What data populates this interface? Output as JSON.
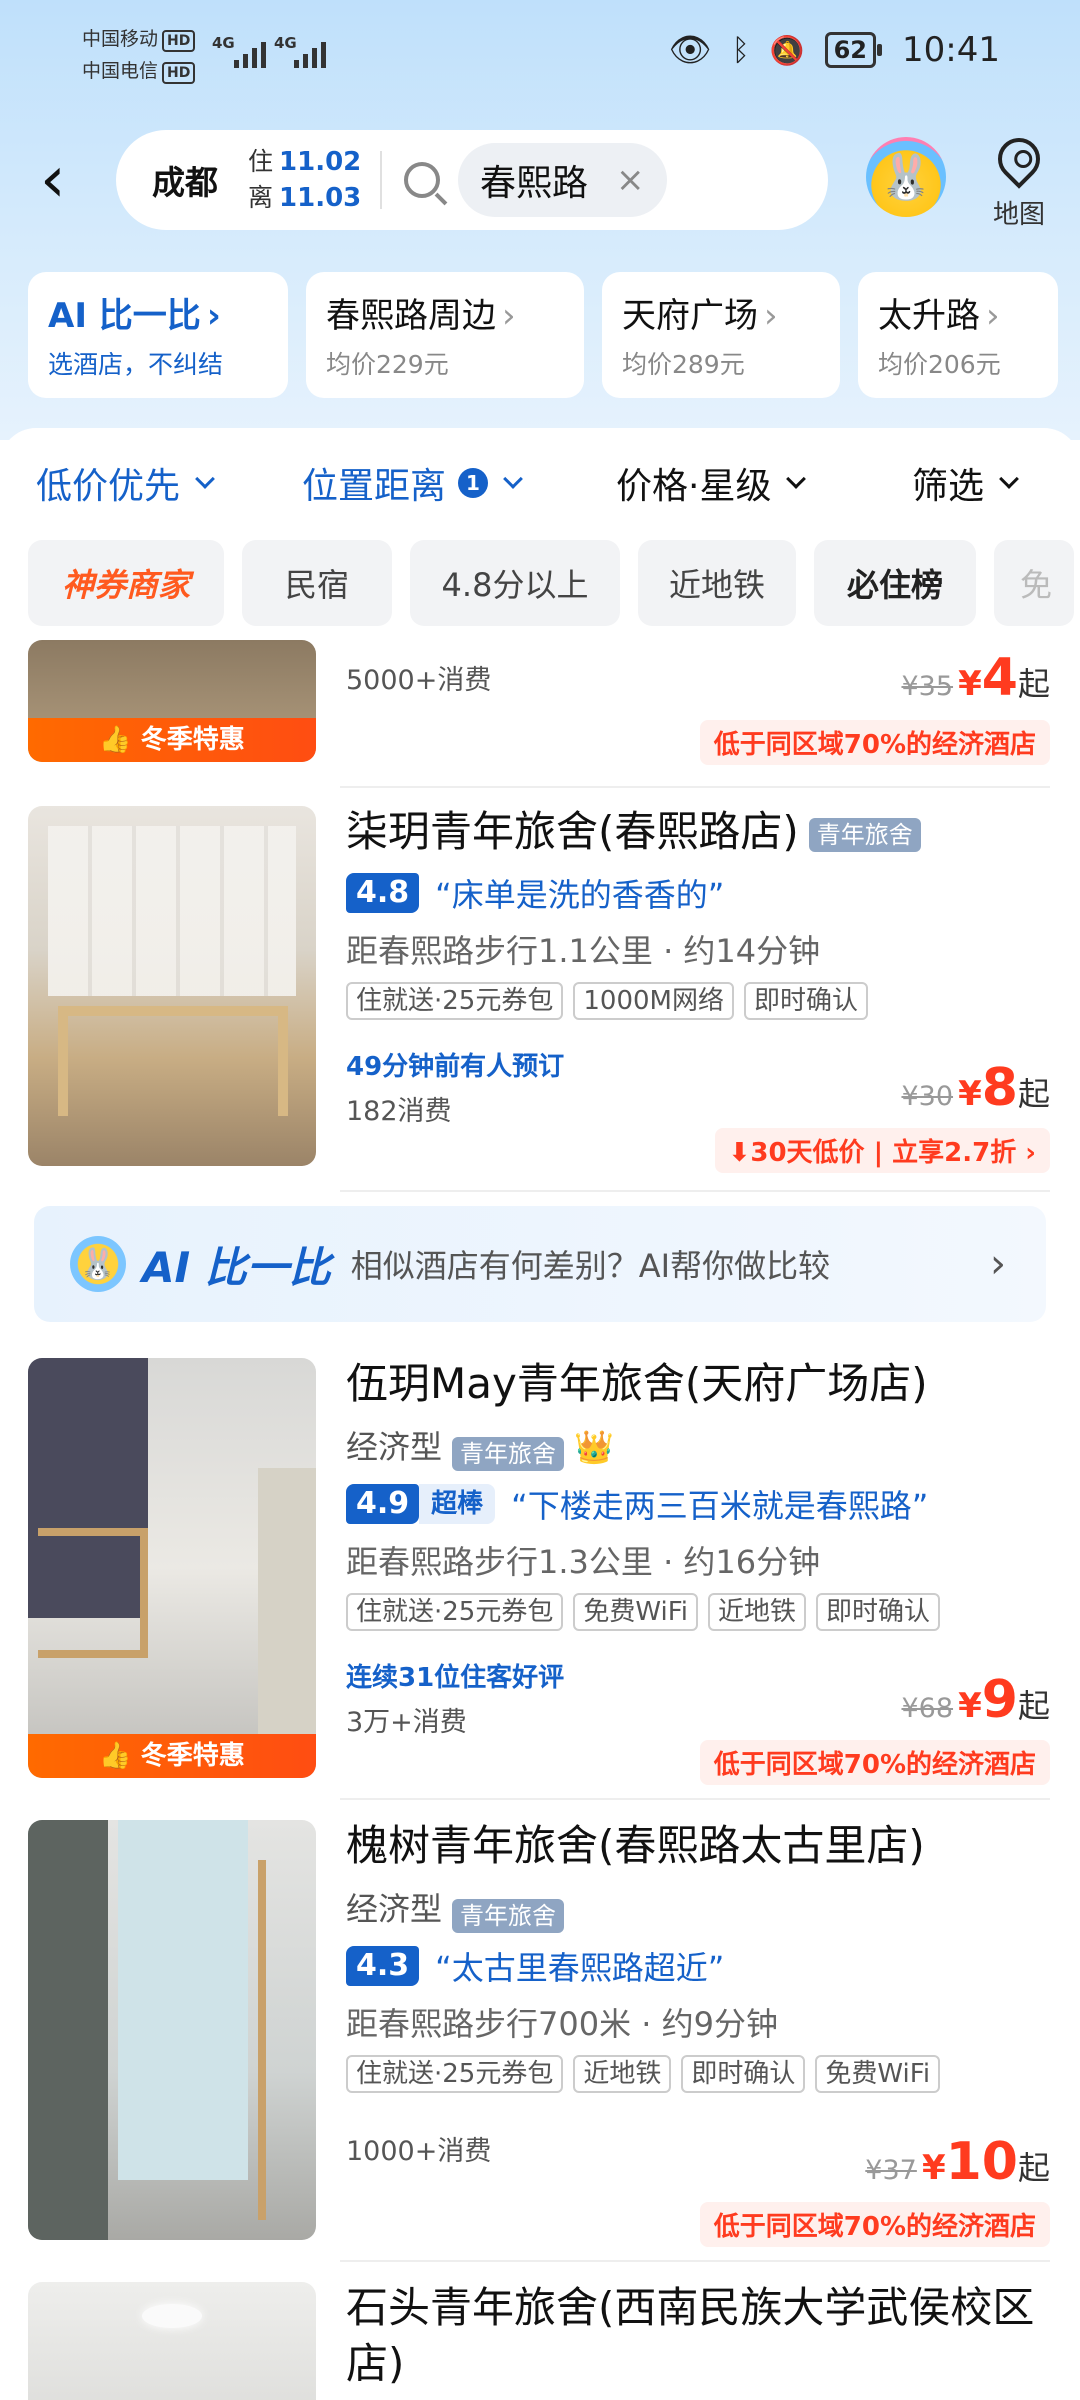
{
  "status_bar": {
    "carrier1": "中国移动",
    "carrier2": "中国电信",
    "hd": "HD",
    "net1": "4G",
    "net2": "4G",
    "battery": "62",
    "time": "10:41"
  },
  "search": {
    "city": "成都",
    "checkin_label": "住",
    "checkin": "11.02",
    "checkout_label": "离",
    "checkout": "11.03",
    "keyword": "春熙路",
    "clear": "×",
    "map_label": "地图"
  },
  "quick_cards": [
    {
      "title": "AI 比一比",
      "sub": "选酒店，不纠结"
    },
    {
      "title": "春熙路周边",
      "sub": "均价229元"
    },
    {
      "title": "天府广场",
      "sub": "均价289元"
    },
    {
      "title": "太升路",
      "sub": "均价206元"
    }
  ],
  "sort": {
    "price_first": "低价优先",
    "location": "位置距离",
    "location_badge": "1",
    "price_star": "价格·星级",
    "filter": "筛选"
  },
  "tags": [
    "神券商家",
    "民宿",
    "4.8分以上",
    "近地铁",
    "必住榜",
    "免"
  ],
  "list": {
    "partial": {
      "consume": "5000+消费",
      "old_price": "¥35",
      "currency": "¥",
      "price": "4",
      "qi": "起",
      "deal": "低于同区域70%的经济酒店",
      "winter": "冬季特惠"
    },
    "hotel1": {
      "name": "柒玥青年旅舍(春熙路店)",
      "type": "青年旅舍",
      "score": "4.8",
      "quote": "“床单是洗的香香的”",
      "dist": "距春熙路步行1.1公里 · 约14分钟",
      "facs": [
        "住就送·25元券包",
        "1000M网络",
        "即时确认"
      ],
      "recent": "49分钟前有人预订",
      "consume": "182消费",
      "old_price": "¥30",
      "currency": "¥",
      "price": "8",
      "qi": "起",
      "deal": "30天低价 | 立享2.7折"
    },
    "ai_banner": {
      "title": "AI 比一比",
      "sub": "相似酒店有何差别？AI帮你做比较",
      "arrow": "›"
    },
    "hotel2": {
      "name": "伍玥May青年旅舍(天府广场店)",
      "eco": "经济型",
      "type": "青年旅舍",
      "score": "4.9",
      "score_tag": "超棒",
      "quote": "“下楼走两三百米就是春熙路”",
      "dist": "距春熙路步行1.3公里 · 约16分钟",
      "facs": [
        "住就送·25元券包",
        "免费WiFi",
        "近地铁",
        "即时确认"
      ],
      "recent": "连续31位住客好评",
      "consume": "3万+消费",
      "old_price": "¥68",
      "currency": "¥",
      "price": "9",
      "qi": "起",
      "deal": "低于同区域70%的经济酒店",
      "winter": "冬季特惠"
    },
    "hotel3": {
      "name": "槐树青年旅舍(春熙路太古里店)",
      "eco": "经济型",
      "type": "青年旅舍",
      "score": "4.3",
      "quote": "“太古里春熙路超近”",
      "dist": "距春熙路步行700米 · 约9分钟",
      "facs": [
        "住就送·25元券包",
        "近地铁",
        "即时确认",
        "免费WiFi"
      ],
      "consume": "1000+消费",
      "old_price": "¥37",
      "currency": "¥",
      "price": "10",
      "qi": "起",
      "deal": "低于同区域70%的经济酒店"
    },
    "hotel4": {
      "name": "石头青年旅舍(西南民族大学武侯校区店)"
    }
  }
}
